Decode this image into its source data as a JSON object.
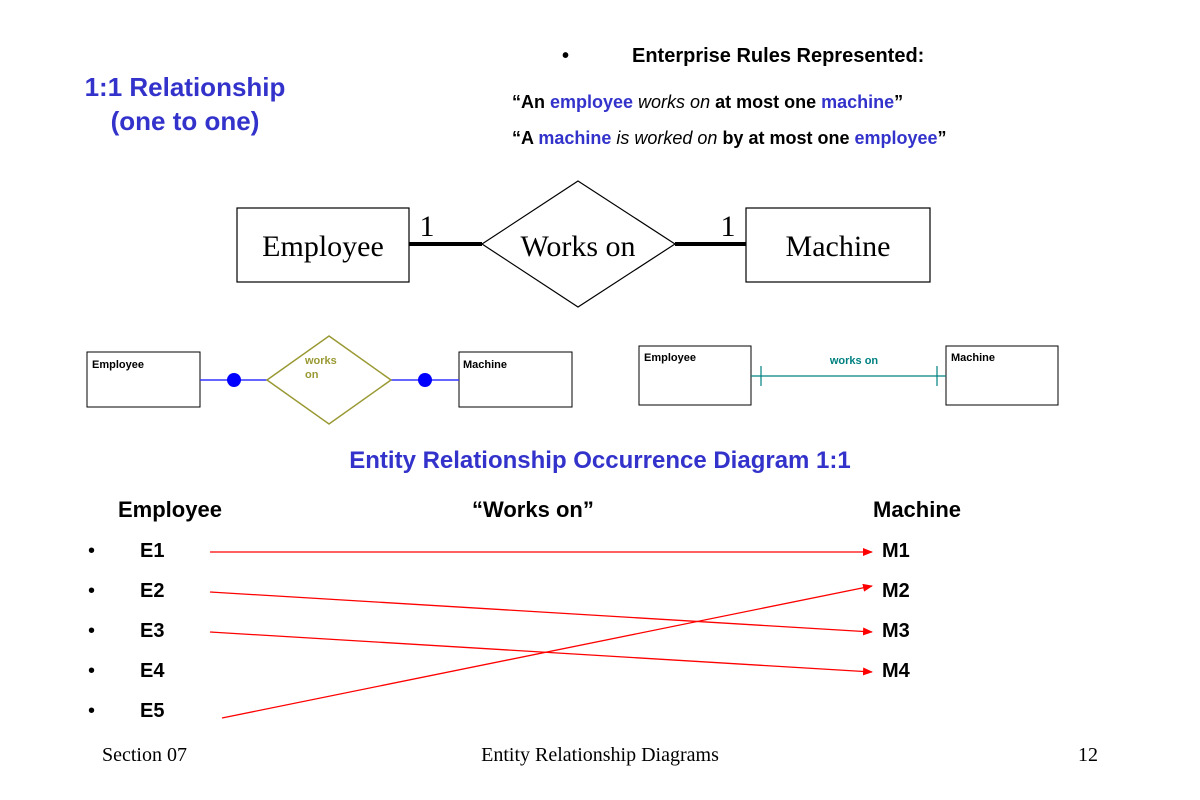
{
  "slide": {
    "title_line1": "1:1 Relationship",
    "title_line2": "(one to one)",
    "rules_heading": "Enterprise Rules Represented:",
    "rule1": {
      "q_open": "“An ",
      "entity1": "employee",
      "verb": " works on",
      "rest": " at most one ",
      "entity2": "machine",
      "q_close": "”"
    },
    "rule2": {
      "q_open": "“A ",
      "entity1": "machine",
      "verb": " is worked on",
      "rest": " by at most one ",
      "entity2": "employee",
      "q_close": "”"
    }
  },
  "chen_diagram": {
    "entity_left": "Employee",
    "relationship": "Works on",
    "entity_right": "Machine",
    "card_left": "1",
    "card_right": "1"
  },
  "alt_diagram_1": {
    "entity_left": "Employee",
    "relationship_line1": "works",
    "relationship_line2": "on",
    "entity_right": "Machine"
  },
  "alt_diagram_2": {
    "entity_left": "Employee",
    "relationship": "works on",
    "entity_right": "Machine"
  },
  "occurrence": {
    "title": "Entity Relationship Occurrence Diagram 1:1",
    "col_left": "Employee",
    "col_mid": "“Works on”",
    "col_right": "Machine",
    "bullet": "•",
    "employees": [
      "E1",
      "E2",
      "E3",
      "E4",
      "E5"
    ],
    "machines": [
      "M1",
      "M2",
      "M3",
      "M4"
    ],
    "links": [
      {
        "from": "E1",
        "to": "M1"
      },
      {
        "from": "E2",
        "to": "M3"
      },
      {
        "from": "E3",
        "to": "M4"
      },
      {
        "from": "E5",
        "to": "M2"
      }
    ]
  },
  "footer": {
    "left": "Section 07",
    "center": "Entity Relationship Diagrams",
    "right": "12"
  },
  "colors": {
    "title_blue": "#3333cc",
    "link_red": "#ff0000",
    "chen_line": "#000000",
    "alt1_line": "#3333ff",
    "alt1_diamond": "#999933",
    "alt1_dot": "#0000ff",
    "alt2_line": "#008080"
  }
}
